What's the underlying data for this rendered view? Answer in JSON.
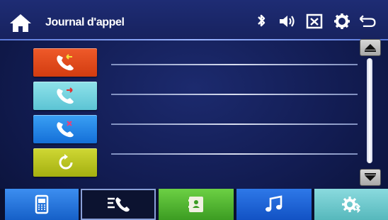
{
  "header": {
    "title": "Journal d'appel",
    "icons": [
      "home-icon",
      "bluetooth-icon",
      "volume-icon",
      "close-icon",
      "settings-icon",
      "back-icon"
    ]
  },
  "calls": [
    {
      "type": "incoming",
      "icon": "incoming-call-icon",
      "color": "#e0491e",
      "text": ""
    },
    {
      "type": "outgoing",
      "icon": "outgoing-call-icon",
      "color": "#74d4e0",
      "text": ""
    },
    {
      "type": "missed",
      "icon": "missed-call-icon",
      "color": "#1f86e8",
      "text": ""
    },
    {
      "type": "refresh",
      "icon": "refresh-icon",
      "color": "#b8c41a",
      "text": ""
    }
  ],
  "tabs": [
    {
      "name": "phone",
      "icon": "phone-icon",
      "color": "#1e72d8",
      "active": false
    },
    {
      "name": "call-log",
      "icon": "call-log-icon",
      "color": "#0d1433",
      "active": true
    },
    {
      "name": "contacts",
      "icon": "contacts-icon",
      "color": "#52b832",
      "active": false
    },
    {
      "name": "music",
      "icon": "music-icon",
      "color": "#1a5fd4",
      "active": false
    },
    {
      "name": "settings",
      "icon": "bt-settings-icon",
      "color": "#6fc8cc",
      "active": false
    }
  ]
}
